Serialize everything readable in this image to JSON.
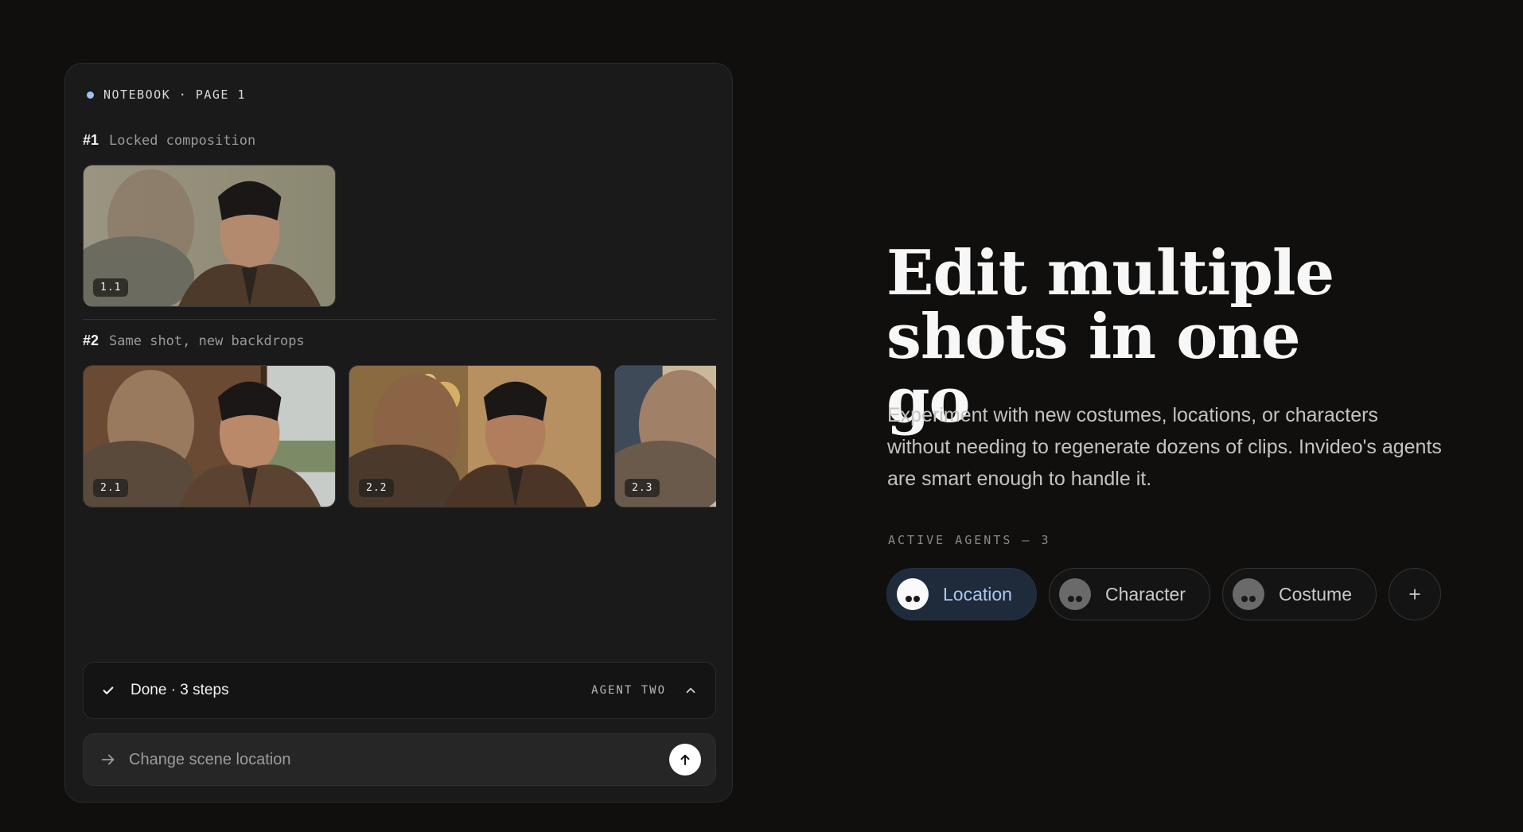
{
  "notebook": {
    "header": "NOTEBOOK · PAGE 1",
    "groups": [
      {
        "number": "#1",
        "title": "Locked composition",
        "shots": [
          {
            "label": "1.1"
          }
        ]
      },
      {
        "number": "#2",
        "title": "Same shot, new backdrops",
        "shots": [
          {
            "label": "2.1"
          },
          {
            "label": "2.2"
          },
          {
            "label": "2.3"
          }
        ]
      }
    ],
    "status": {
      "text": "Done · 3 steps",
      "agent": "AGENT TWO",
      "icon_left": "check-icon",
      "icon_right": "chevron-up-icon"
    },
    "input": {
      "placeholder": "Change scene location",
      "value": "",
      "icon": "arrow-right-icon",
      "send_icon": "arrow-up-icon"
    }
  },
  "hero": {
    "headline_line1": "Edit multiple",
    "headline_line2": "shots in one go",
    "body": "Experiment with new costumes, locations, or characters without needing to regenerate dozens of clips. Invideo's agents are smart enough to handle it."
  },
  "agents": {
    "label": "ACTIVE AGENTS — 3",
    "chips": [
      {
        "label": "Location",
        "active": true
      },
      {
        "label": "Character",
        "active": false
      },
      {
        "label": "Costume",
        "active": false
      }
    ],
    "add_icon": "plus-icon"
  },
  "colors": {
    "background": "#100f0e",
    "panel": "#1a1a1a",
    "accent": "#a9c8f0",
    "active_chip": "#1f2a3a"
  }
}
